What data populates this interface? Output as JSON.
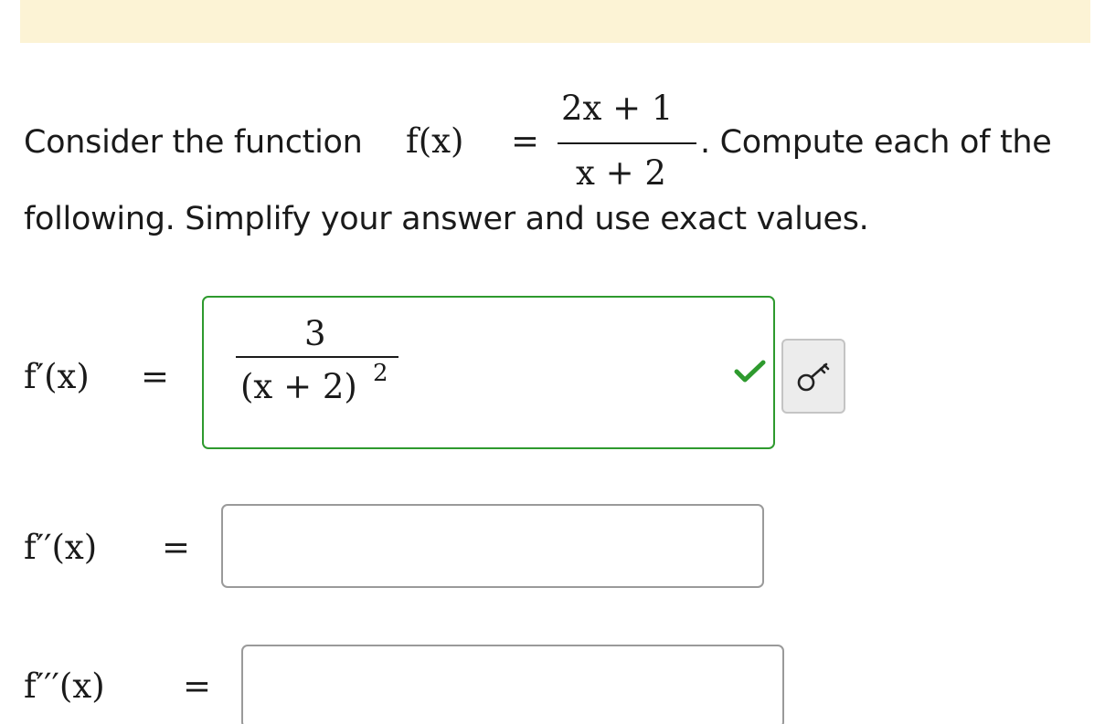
{
  "question": {
    "text_before": "Consider the function",
    "function_label": "f(x)",
    "equals": "=",
    "numerator": "2x + 1",
    "denominator": "x + 2",
    "text_after": ". Compute each of the",
    "line2": "following. Simplify your answer and use exact values."
  },
  "parts": [
    {
      "label": "f′(x)",
      "equals": "=",
      "status": "correct",
      "answer": {
        "numerator": "3",
        "denominator": "(x + 2)",
        "exponent": "2"
      }
    },
    {
      "label": "f′′(x)",
      "equals": "=",
      "value": ""
    },
    {
      "label": "f′′′(x)",
      "equals": "=",
      "value": ""
    }
  ],
  "icons": {
    "correct": "check-icon",
    "answer_key": "key-icon"
  },
  "colors": {
    "banner": "#fcf3d5",
    "correct_border": "#2e9a2e",
    "input_border": "#9a9a9a",
    "key_button_bg": "#ececec"
  }
}
